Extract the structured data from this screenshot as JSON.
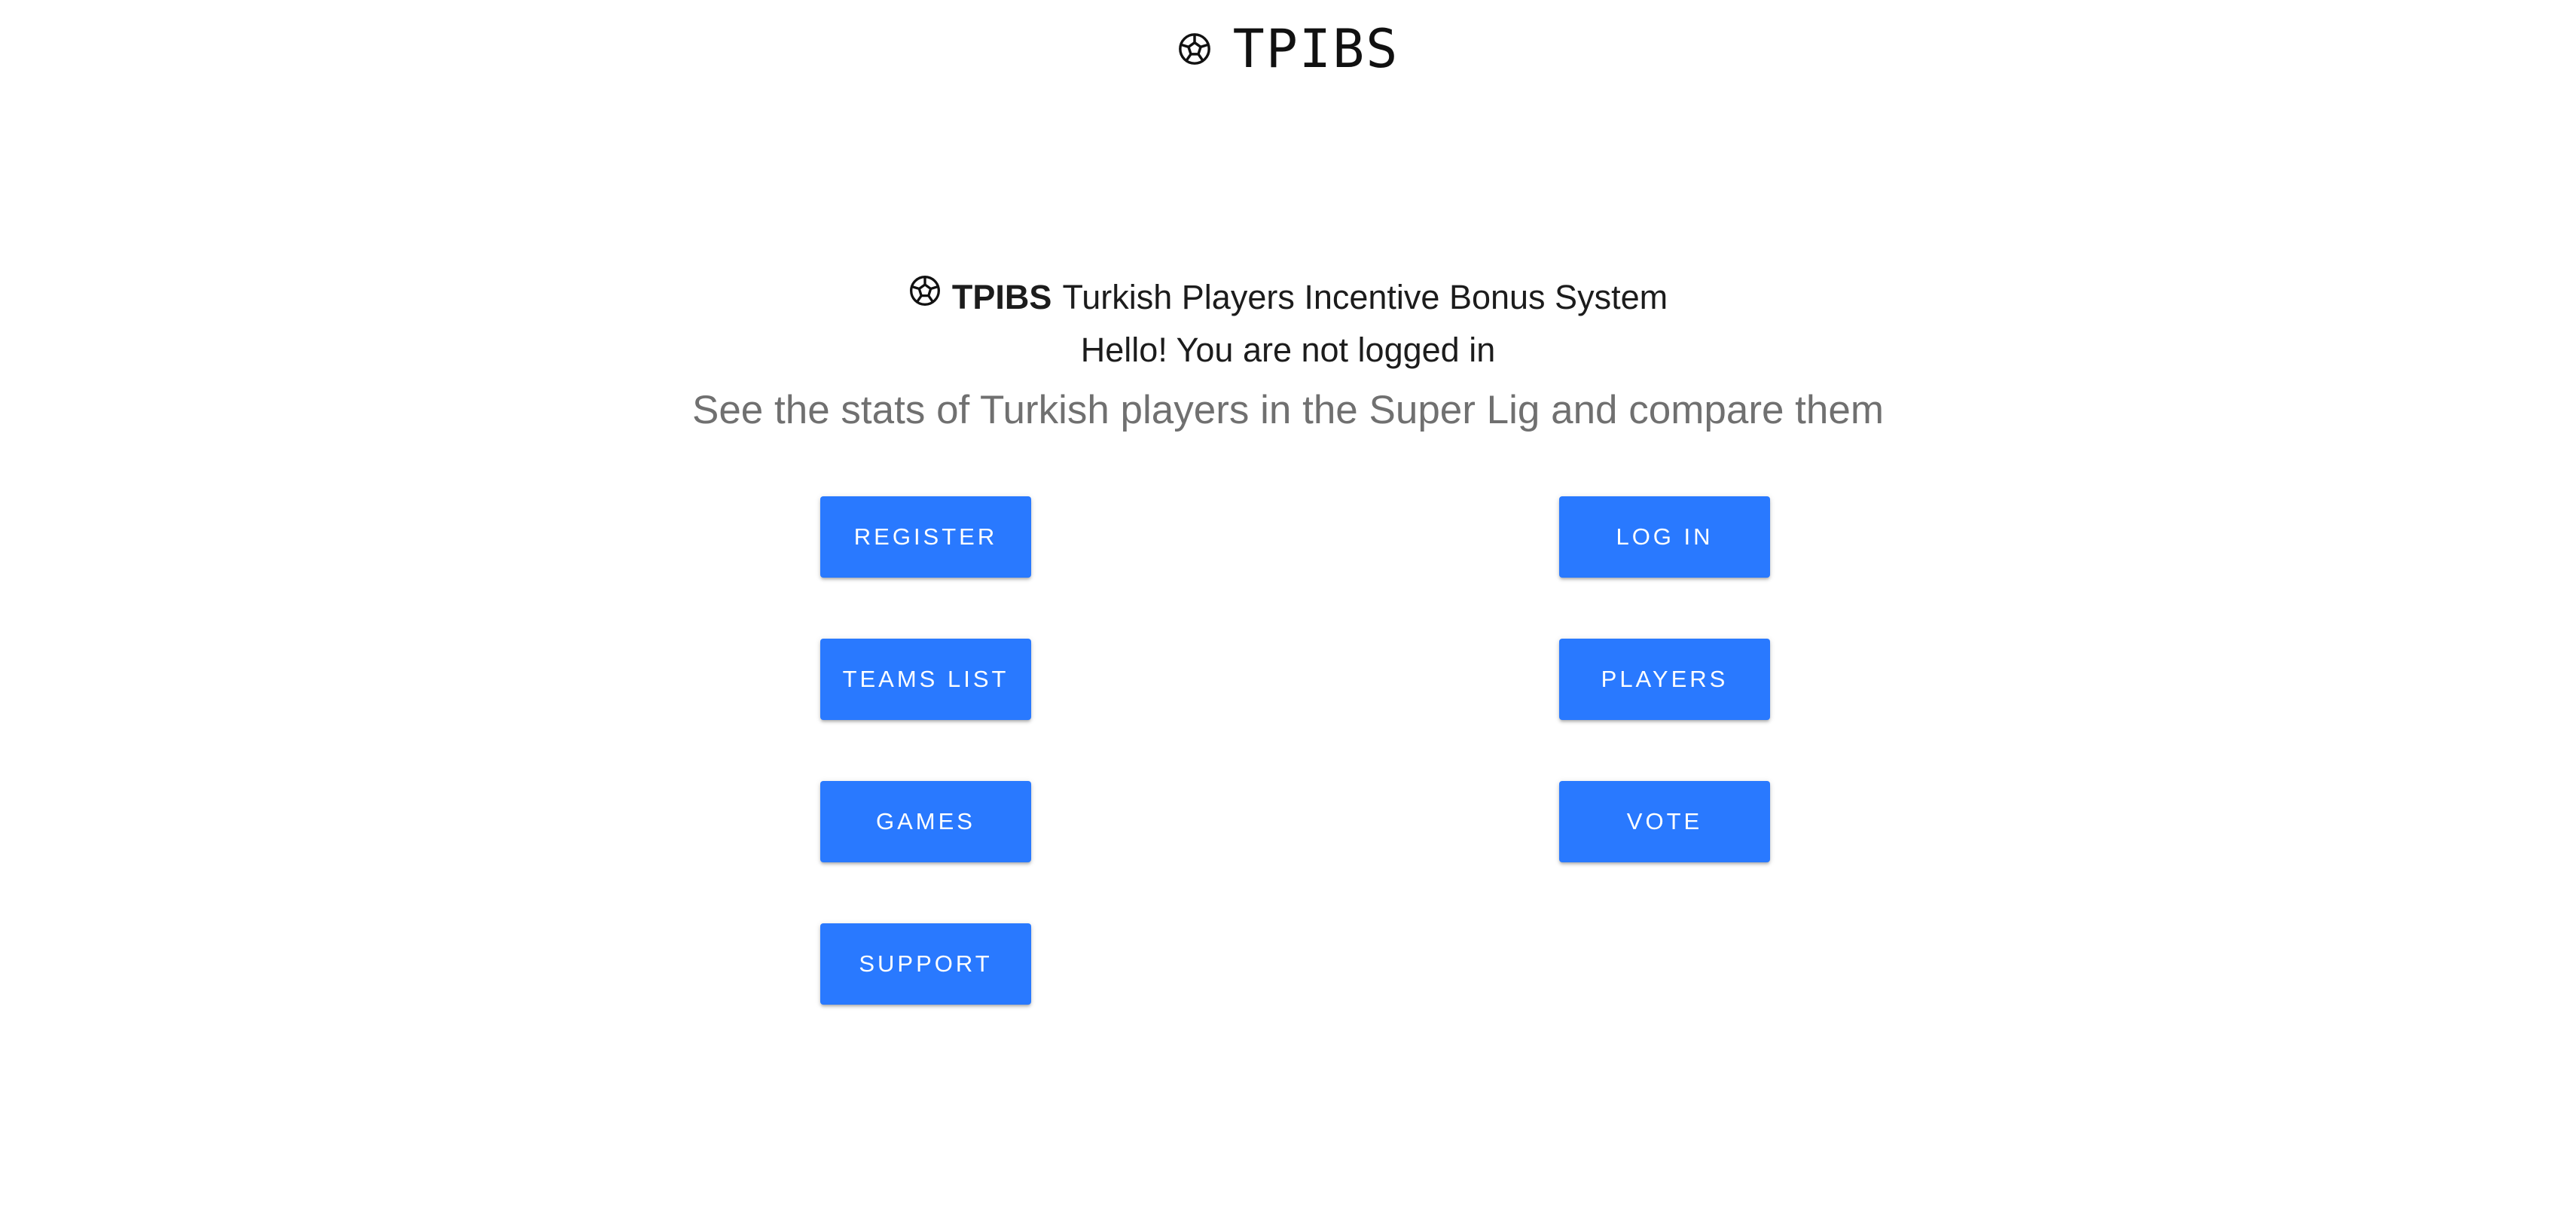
{
  "header": {
    "icon": "soccer-ball-icon",
    "brand": "TPIBS"
  },
  "hero": {
    "icon": "soccer-ball-icon",
    "acronym": "TPIBS",
    "full_name": "Turkish Players Incentive Bonus System",
    "greeting": "Hello! You are not logged in",
    "tagline": "See the stats of Turkish players in the Super Lig and compare them"
  },
  "buttons": {
    "register": "REGISTER",
    "login": "LOG IN",
    "teams_list": "TEAMS LIST",
    "players": "PLAYERS",
    "games": "GAMES",
    "vote": "VOTE",
    "support": "SUPPORT"
  },
  "colors": {
    "button_background": "#2979ff",
    "button_text": "#ffffff",
    "tagline_text": "#707070"
  }
}
